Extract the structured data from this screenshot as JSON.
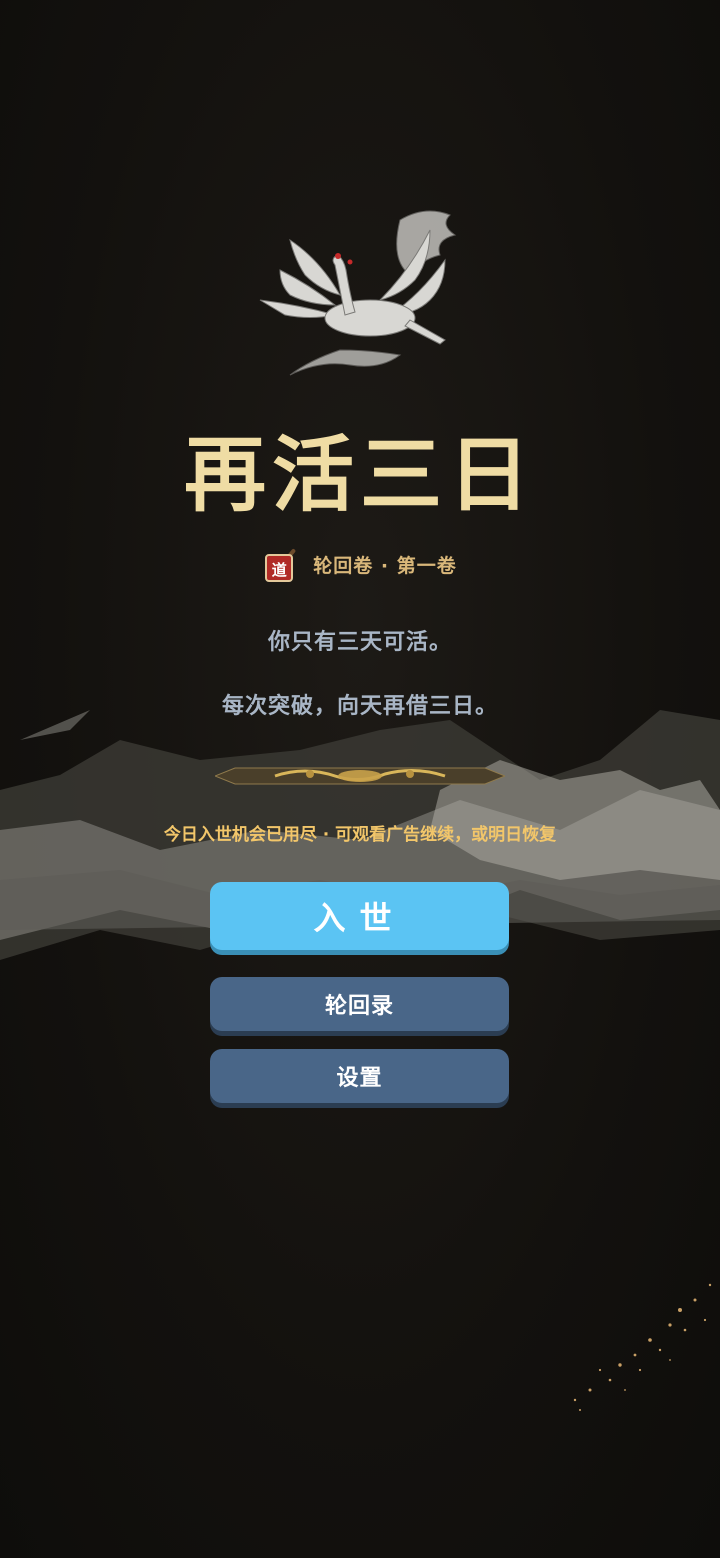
{
  "game": {
    "title": "再活三日",
    "volume_label": "轮回卷 · 第一卷",
    "seal_char": "道",
    "tagline_1": "你只有三天可活。",
    "tagline_2": "每次突破，向天再借三日。",
    "notice": "今日入世机会已用尽 · 可观看广告继续，或明日恢复"
  },
  "menu": {
    "enter_label": "入世",
    "records_label": "轮回录",
    "settings_label": "设置"
  },
  "colors": {
    "title": "#efdca4",
    "subtitle": "#d9b77a",
    "tagline": "#a9b6c6",
    "notice": "#f2c66a",
    "primary_button": "#5bc4f3",
    "secondary_button": "#496688",
    "background": "#13110e"
  },
  "icons": [
    "crane-emblem-icon",
    "dao-seal-icon",
    "ornament-divider-icon"
  ]
}
